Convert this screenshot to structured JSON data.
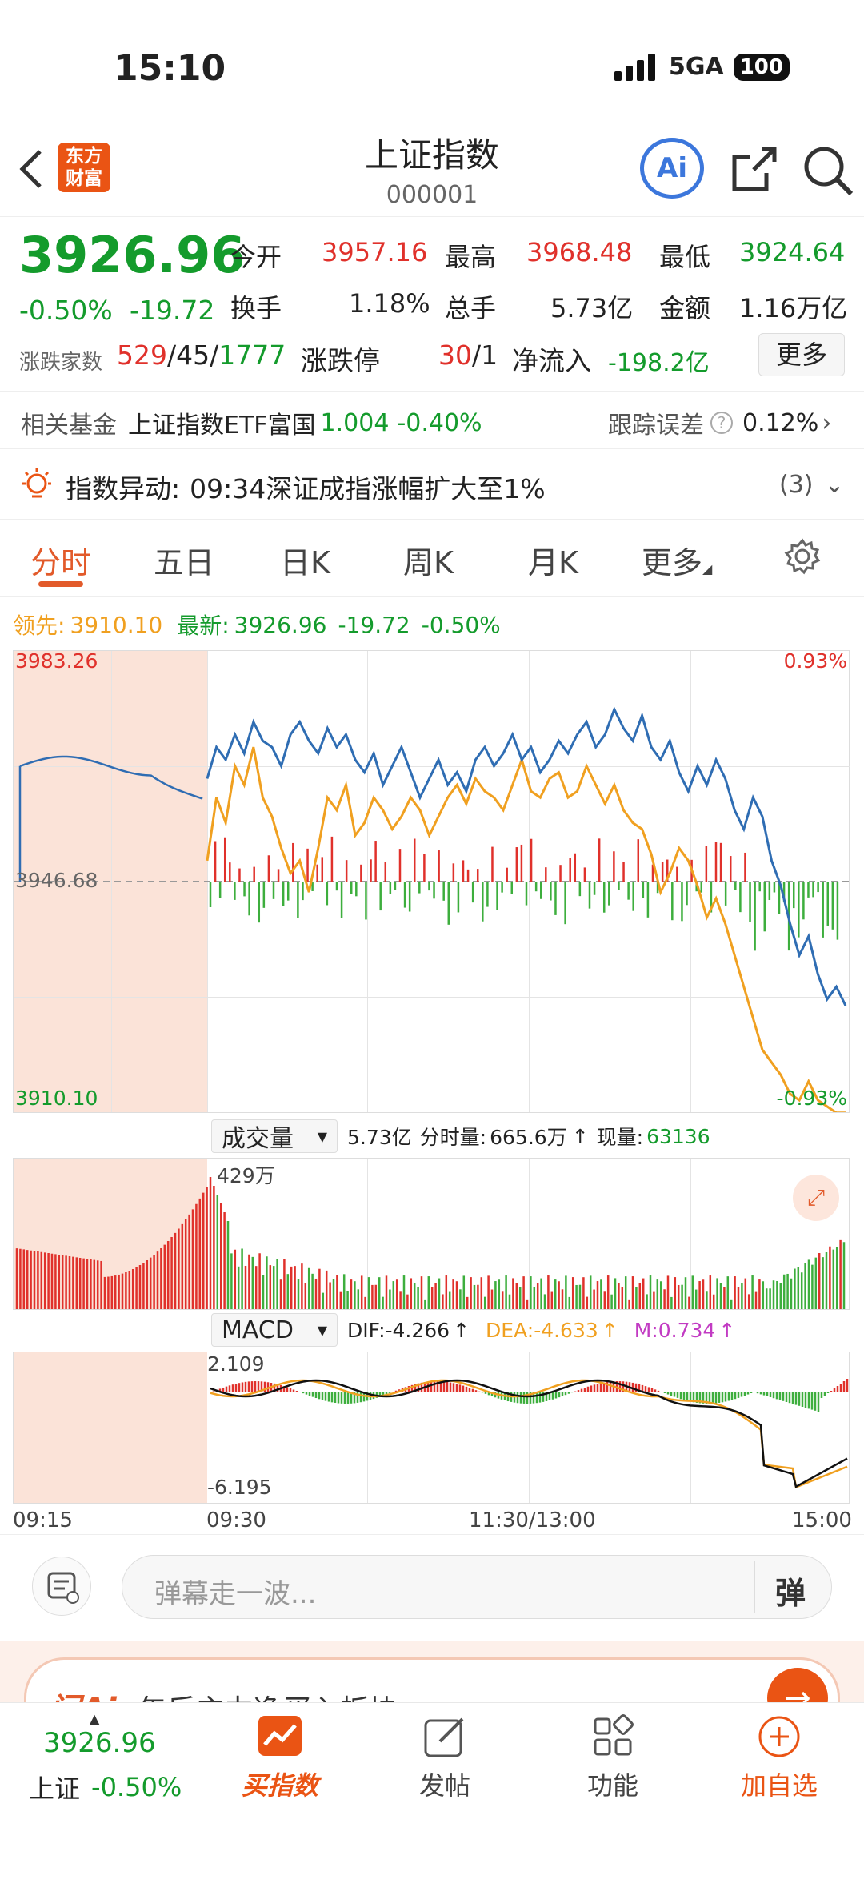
{
  "status": {
    "time": "15:10",
    "network": "5GA",
    "battery": "100"
  },
  "header": {
    "title": "上证指数",
    "code": "000001",
    "logo": "东方财富",
    "ai": "Ai"
  },
  "quote": {
    "price": "3926.96",
    "change_pct": "-0.50%",
    "change": "-19.72",
    "open_label": "今开",
    "open": "3957.16",
    "high_label": "最高",
    "high": "3968.48",
    "low_label": "最低",
    "low": "3924.64",
    "turnover_label": "换手",
    "turnover": "1.18%",
    "volume_label": "总手",
    "volume": "5.73亿",
    "amount_label": "金额",
    "amount": "1.16万亿",
    "breadth_label": "涨跌家数",
    "adv": "529",
    "flat": "45",
    "dec": "1777",
    "limit_label": "涨跌停",
    "limit_up": "30",
    "limit_down": "1",
    "netflow_label": "净流入",
    "netflow": "-198.2亿",
    "more_label": "更多"
  },
  "fund": {
    "label": "相关基金",
    "name": "上证指数ETF富国",
    "price": "1.004",
    "pct": "-0.40%",
    "track_label": "跟踪误差",
    "track_value": "0.12%"
  },
  "alert": {
    "label": "指数异动:",
    "text": "09:34深证成指涨幅扩大至1%",
    "count": "(3)"
  },
  "tabs": [
    "分时",
    "五日",
    "日K",
    "周K",
    "月K",
    "更多"
  ],
  "legend": {
    "lead_label": "领先:",
    "lead_value": "3910.10",
    "last_label": "最新:",
    "last_value": "3926.96",
    "chg": "-19.72",
    "pct": "-0.50%"
  },
  "chart_data": [
    {
      "type": "line",
      "series": [
        {
          "name": "最新",
          "color": "#2f6db3"
        },
        {
          "name": "领先",
          "color": "#f0a020"
        }
      ],
      "x_ticks": [
        "09:15",
        "09:30",
        "11:30/13:00",
        "15:00"
      ],
      "y_max_label": "3983.26",
      "y_mid_label": "3946.68",
      "y_min_label": "3910.10",
      "pct_max_label": "0.93%",
      "pct_min_label": "-0.93%",
      "ylim": [
        3910.1,
        3983.26
      ],
      "price_points": [
        3963,
        3968,
        3966,
        3970,
        3967,
        3972,
        3969,
        3968,
        3965,
        3970,
        3972,
        3969,
        3967,
        3971,
        3968,
        3970,
        3966,
        3964,
        3967,
        3962,
        3965,
        3968,
        3964,
        3960,
        3963,
        3966,
        3962,
        3964,
        3961,
        3966,
        3968,
        3965,
        3967,
        3970,
        3966,
        3968,
        3964,
        3966,
        3969,
        3967,
        3970,
        3972,
        3968,
        3970,
        3974,
        3971,
        3969,
        3973,
        3968,
        3966,
        3969,
        3964,
        3961,
        3965,
        3962,
        3966,
        3963,
        3958,
        3955,
        3960,
        3957,
        3950,
        3946,
        3940,
        3935,
        3938,
        3932,
        3928,
        3930,
        3927
      ],
      "lead_points": [
        3950,
        3960,
        3956,
        3965,
        3962,
        3968,
        3960,
        3957,
        3952,
        3948,
        3950,
        3945,
        3952,
        3960,
        3958,
        3962,
        3954,
        3956,
        3960,
        3958,
        3955,
        3957,
        3960,
        3958,
        3954,
        3957,
        3960,
        3962,
        3959,
        3963,
        3961,
        3960,
        3958,
        3962,
        3966,
        3961,
        3960,
        3963,
        3964,
        3960,
        3961,
        3965,
        3962,
        3959,
        3962,
        3958,
        3956,
        3955,
        3951,
        3945,
        3948,
        3952,
        3950,
        3946,
        3941,
        3944,
        3940,
        3935,
        3930,
        3925,
        3920,
        3918,
        3916,
        3913,
        3912,
        3915,
        3912,
        3911,
        3910,
        3910
      ]
    },
    {
      "type": "bar",
      "title": "成交量",
      "total": "5.73亿",
      "minute_label": "分时量:",
      "minute": "665.6万",
      "now_label": "现量:",
      "now": "63136",
      "max_label": "429万"
    },
    {
      "type": "line",
      "title": "MACD",
      "dif_label": "DIF:",
      "dif": "-4.266",
      "dea_label": "DEA:",
      "dea": "-4.633",
      "m_label": "M:",
      "m": "0.734",
      "max_label": "2.109",
      "min_label": "-6.195"
    }
  ],
  "comment": {
    "placeholder": "弹幕走一波...",
    "btn": "弹"
  },
  "banner": {
    "text": "午后主力净买入板块"
  },
  "bottom": {
    "price": "3926.96",
    "name": "上证",
    "pct": "-0.50%",
    "buy": "买指数",
    "post": "发帖",
    "func": "功能",
    "add": "加自选"
  }
}
